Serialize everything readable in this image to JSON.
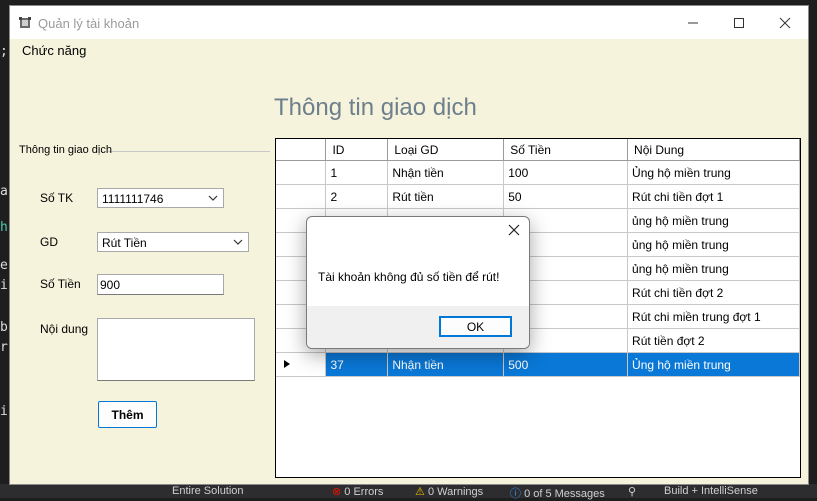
{
  "window": {
    "title": "Quản lý tài khoản"
  },
  "menu": {
    "items": [
      "Chức năng"
    ]
  },
  "heading": "Thông tin giao dịch",
  "form": {
    "group_title": "Thông tin giao dịch",
    "account_label": "Số TK",
    "account_value": "1111111746",
    "type_label": "GD",
    "type_value": "Rút Tiền",
    "amount_label": "Số Tiền",
    "amount_value": "900",
    "content_label": "Nội dung",
    "content_value": "",
    "add_button": "Thêm"
  },
  "grid": {
    "columns": [
      "ID",
      "Loại GD",
      "Số Tiền",
      "Nội Dung"
    ],
    "rows": [
      [
        "1",
        "Nhận tiền",
        "100",
        "Ủng hộ miền trung"
      ],
      [
        "2",
        "Rút tiền",
        "50",
        "Rút chi tiền đợt 1"
      ],
      [
        "",
        "",
        "",
        "ủng hộ miền trung"
      ],
      [
        "",
        "",
        "",
        "ủng hộ miền trung"
      ],
      [
        "",
        "",
        "",
        "ủng hộ miền trung"
      ],
      [
        "",
        "",
        "",
        "Rút chi tiền đợt 2"
      ],
      [
        "",
        "",
        "",
        "Rút chi miền trung đợt 1"
      ],
      [
        "",
        "",
        "",
        "Rút tiền đợt 2"
      ],
      [
        "37",
        "Nhận tiền",
        "500",
        "Ủng hộ miền trung"
      ]
    ],
    "selected_row": 8
  },
  "message_box": {
    "text": "Tài khoản không đủ số tiền để rút!",
    "ok_label": "OK"
  },
  "ide_status": {
    "solution": "Entire Solution",
    "errors": "0 Errors",
    "warnings": "0 Warnings",
    "messages": "0 of 5 Messages",
    "build": "Build + IntelliSense"
  },
  "colors": {
    "selection": "#0a78d7",
    "window_bg": "#f5f3dc",
    "accent": "#0078d7"
  }
}
